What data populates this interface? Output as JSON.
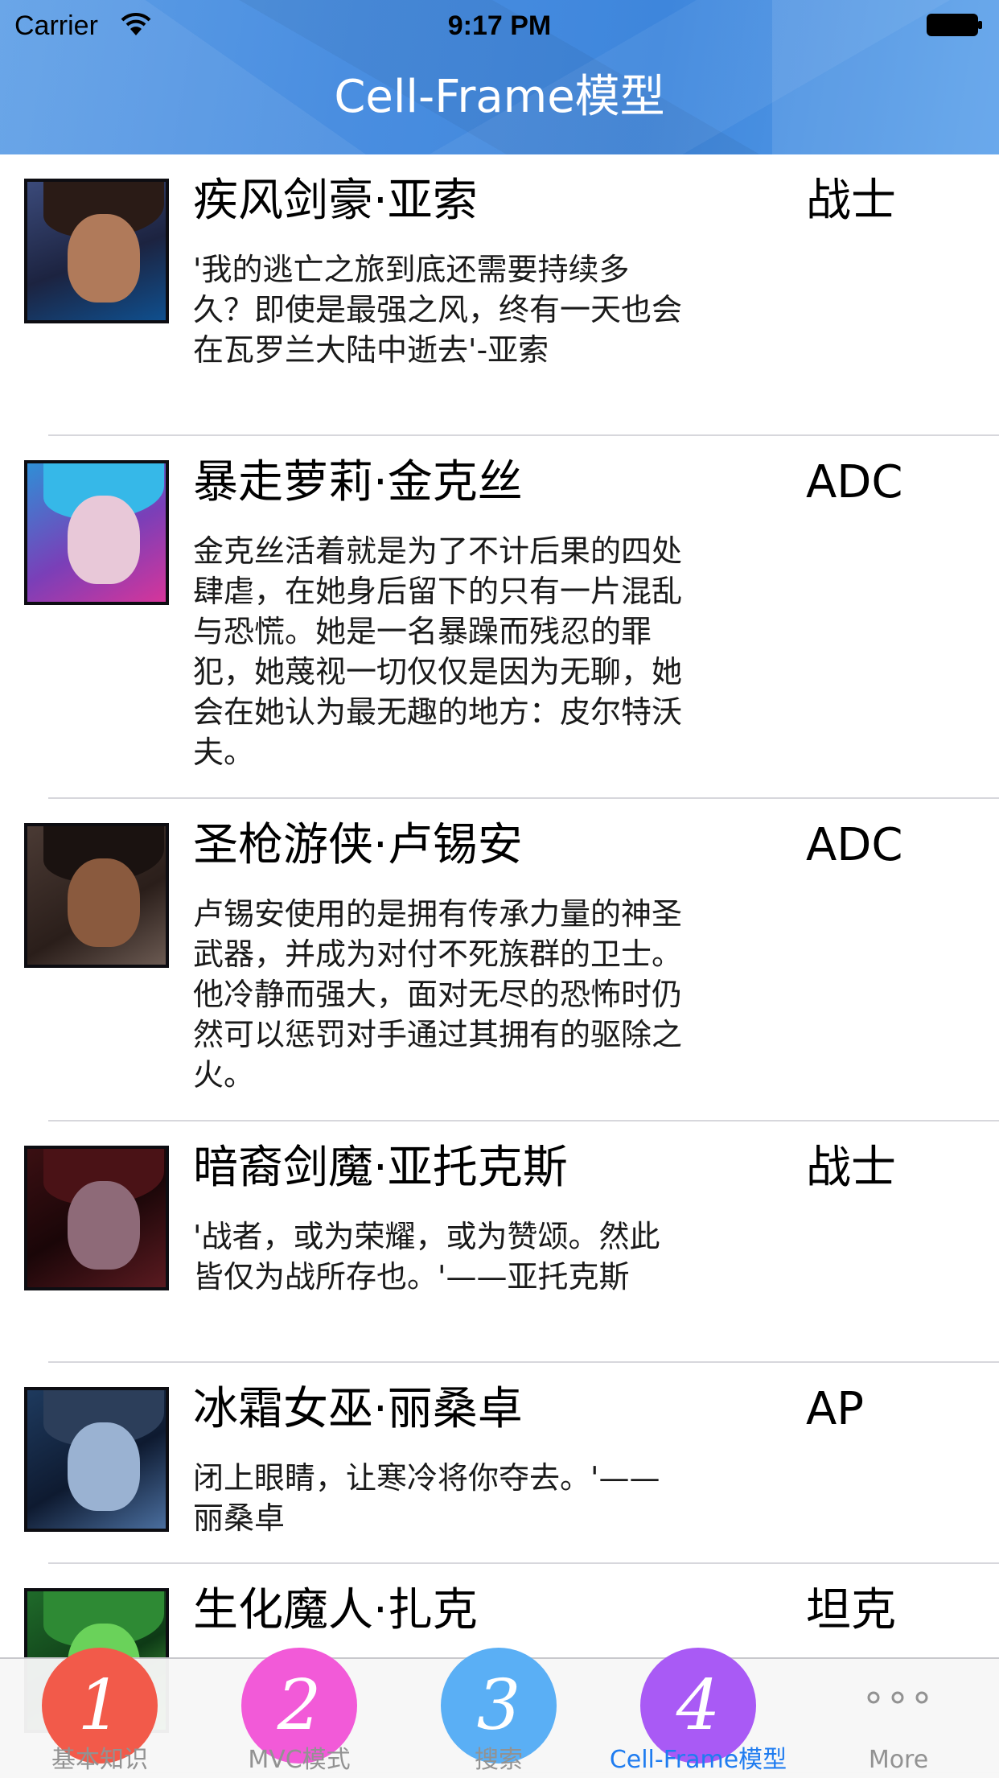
{
  "status_bar": {
    "carrier": "Carrier",
    "time": "9:17 PM"
  },
  "nav": {
    "title": "Cell-Frame模型",
    "background": "#4a8ee0"
  },
  "heroes": [
    {
      "name": "疾风剑豪·亚索",
      "type": "战士",
      "desc": "'我的逃亡之旅到底还需要持续多久？即使是最强之风，终有一天也会在瓦罗兰大陆中逝去'-亚索",
      "avatar": "yasuo-avatar"
    },
    {
      "name": "暴走萝莉·金克丝",
      "type": "ADC",
      "desc": "金克丝活着就是为了不计后果的四处肆虐，在她身后留下的只有一片混乱与恐慌。她是一名暴躁而残忍的罪犯，她蔑视一切仅仅是因为无聊，她会在她认为最无趣的地方：皮尔特沃夫。",
      "avatar": "jinx-avatar"
    },
    {
      "name": "圣枪游侠·卢锡安",
      "type": "ADC",
      "desc": "卢锡安使用的是拥有传承力量的神圣武器，并成为对付不死族群的卫士。他冷静而强大，面对无尽的恐怖时仍然可以惩罚对手通过其拥有的驱除之火。",
      "avatar": "lucian-avatar"
    },
    {
      "name": "暗裔剑魔·亚托克斯",
      "type": "战士",
      "desc": "'战者，或为荣耀，或为赞颂。然此皆仅为战所存也。'——亚托克斯",
      "avatar": "aatrox-avatar"
    },
    {
      "name": "冰霜女巫·丽桑卓",
      "type": "AP",
      "desc": "闭上眼睛，让寒冷将你夺去。'——丽桑卓",
      "avatar": "lissandra-avatar"
    },
    {
      "name": "生化魔人·扎克",
      "type": "坦克",
      "desc": "",
      "avatar": "zac-avatar"
    }
  ],
  "tabbar": {
    "tabs": [
      {
        "glyph": "1",
        "label": "基本知识",
        "color": "#f25a4a",
        "active": false
      },
      {
        "glyph": "2",
        "label": "MVC模式",
        "color": "#f25ad8",
        "active": false
      },
      {
        "glyph": "3",
        "label": "搜索",
        "color": "#5aaff5",
        "active": false
      },
      {
        "glyph": "4",
        "label": "Cell-Frame模型",
        "color": "#a95af5",
        "active": true
      },
      {
        "glyph": "",
        "label": "More",
        "icon": "more-dots-icon",
        "active": false
      }
    ],
    "active_color": "#1f7cf0"
  }
}
